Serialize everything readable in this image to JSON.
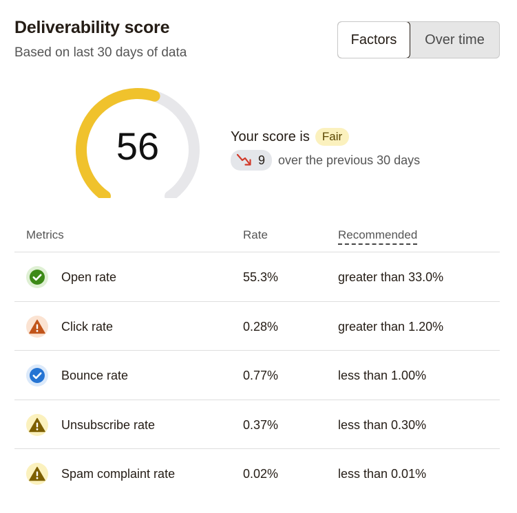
{
  "header": {
    "title": "Deliverability score",
    "subtitle": "Based on last 30 days of data"
  },
  "toggle": {
    "factors_label": "Factors",
    "over_time_label": "Over time",
    "selected": "Factors"
  },
  "score": {
    "value": "56",
    "max": 100,
    "gauge_color": "#f0c22c",
    "track_color": "#e7e7ea",
    "prefix": "Your score is",
    "rating": "Fair",
    "change_icon": "trend-down-icon",
    "change_value": "9",
    "change_text": "over the previous 30 days"
  },
  "table": {
    "headers": {
      "metrics": "Metrics",
      "rate": "Rate",
      "recommended": "Recommended"
    },
    "rows": [
      {
        "icon": "check-circle-icon",
        "status": "good",
        "name": "Open rate",
        "rate": "55.3%",
        "recommended": "greater than 33.0%"
      },
      {
        "icon": "warning-icon",
        "status": "bad",
        "name": "Click rate",
        "rate": "0.28%",
        "recommended": "greater than 1.20%"
      },
      {
        "icon": "check-circle-icon",
        "status": "ok",
        "name": "Bounce rate",
        "rate": "0.77%",
        "recommended": "less than 1.00%"
      },
      {
        "icon": "warning-icon",
        "status": "warn",
        "name": "Unsubscribe rate",
        "rate": "0.37%",
        "recommended": "less than 0.30%"
      },
      {
        "icon": "warning-icon",
        "status": "warn",
        "name": "Spam complaint rate",
        "rate": "0.02%",
        "recommended": "less than 0.01%"
      }
    ]
  },
  "colors": {
    "good": "#3d8a17",
    "bad": "#c1551b",
    "ok": "#2574d3",
    "warn": "#7d5f00"
  }
}
